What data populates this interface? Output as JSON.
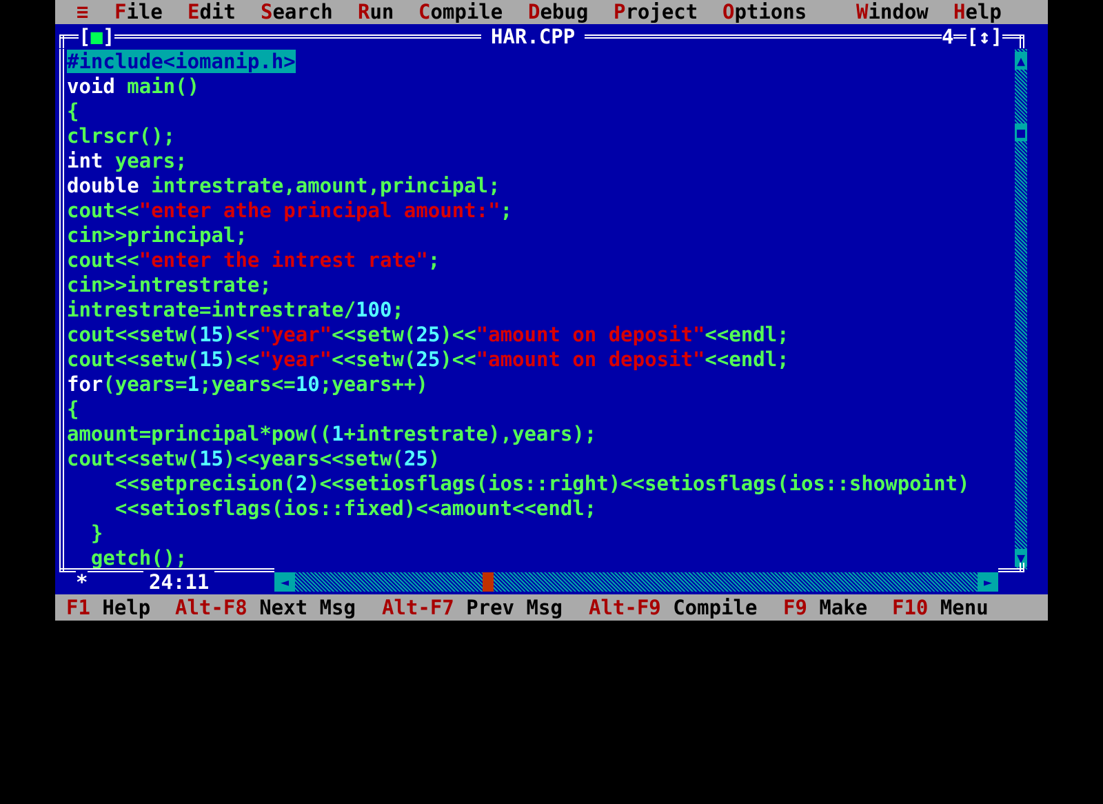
{
  "menu": {
    "system": "≡",
    "items": [
      {
        "hotkey": "F",
        "rest": "ile"
      },
      {
        "hotkey": "E",
        "rest": "dit"
      },
      {
        "hotkey": "S",
        "rest": "earch"
      },
      {
        "hotkey": "R",
        "rest": "un"
      },
      {
        "hotkey": "C",
        "rest": "ompile"
      },
      {
        "hotkey": "D",
        "rest": "ebug"
      },
      {
        "hotkey": "P",
        "rest": "roject"
      },
      {
        "hotkey": "O",
        "rest": "ptions"
      },
      {
        "hotkey": "W",
        "rest": "indow"
      },
      {
        "hotkey": "H",
        "rest": "elp"
      }
    ]
  },
  "window": {
    "title": "HAR.CPP",
    "close_left": "[",
    "close_mark": "■",
    "close_right": "]",
    "number": "4",
    "zoom": "[↕]",
    "cursor_pos": "24:11",
    "modified_mark": "*"
  },
  "editor": {
    "lines": [
      [
        {
          "t": "#include<iomanip.h>",
          "k": "sel"
        }
      ],
      [
        {
          "t": "void",
          "k": "kw"
        },
        {
          "t": " main()",
          "k": "id"
        }
      ],
      [
        {
          "t": "{",
          "k": "id"
        }
      ],
      [
        {
          "t": "clrscr();",
          "k": "id"
        }
      ],
      [
        {
          "t": "int",
          "k": "kw"
        },
        {
          "t": " years;",
          "k": "id"
        }
      ],
      [
        {
          "t": "double",
          "k": "kw"
        },
        {
          "t": " intrestrate,amount,principal;",
          "k": "id"
        }
      ],
      [
        {
          "t": "cout<<",
          "k": "id"
        },
        {
          "t": "\"enter athe principal amount:\"",
          "k": "str"
        },
        {
          "t": ";",
          "k": "id"
        }
      ],
      [
        {
          "t": "cin>>principal;",
          "k": "id"
        }
      ],
      [
        {
          "t": "cout<<",
          "k": "id"
        },
        {
          "t": "\"enter the intrest rate\"",
          "k": "str"
        },
        {
          "t": ";",
          "k": "id"
        }
      ],
      [
        {
          "t": "cin>>intrestrate;",
          "k": "id"
        }
      ],
      [
        {
          "t": "intrestrate=intrestrate/",
          "k": "id"
        },
        {
          "t": "100",
          "k": "num"
        },
        {
          "t": ";",
          "k": "id"
        }
      ],
      [
        {
          "t": "cout<<setw(",
          "k": "id"
        },
        {
          "t": "15",
          "k": "num"
        },
        {
          "t": ")<<",
          "k": "id"
        },
        {
          "t": "\"year\"",
          "k": "str"
        },
        {
          "t": "<<setw(",
          "k": "id"
        },
        {
          "t": "25",
          "k": "num"
        },
        {
          "t": ")<<",
          "k": "id"
        },
        {
          "t": "\"amount on deposit\"",
          "k": "str"
        },
        {
          "t": "<<endl;",
          "k": "id"
        }
      ],
      [
        {
          "t": "cout<<setw(",
          "k": "id"
        },
        {
          "t": "15",
          "k": "num"
        },
        {
          "t": ")<<",
          "k": "id"
        },
        {
          "t": "\"year\"",
          "k": "str"
        },
        {
          "t": "<<setw(",
          "k": "id"
        },
        {
          "t": "25",
          "k": "num"
        },
        {
          "t": ")<<",
          "k": "id"
        },
        {
          "t": "\"amount on deposit\"",
          "k": "str"
        },
        {
          "t": "<<endl;",
          "k": "id"
        }
      ],
      [
        {
          "t": "for",
          "k": "kw"
        },
        {
          "t": "(years=",
          "k": "id"
        },
        {
          "t": "1",
          "k": "num"
        },
        {
          "t": ";years<=",
          "k": "id"
        },
        {
          "t": "10",
          "k": "num"
        },
        {
          "t": ";years++)",
          "k": "id"
        }
      ],
      [
        {
          "t": "{",
          "k": "id"
        }
      ],
      [
        {
          "t": "amount=principal*pow((",
          "k": "id"
        },
        {
          "t": "1",
          "k": "num"
        },
        {
          "t": "+intrestrate),years);",
          "k": "id"
        }
      ],
      [
        {
          "t": "cout<<setw(",
          "k": "id"
        },
        {
          "t": "15",
          "k": "num"
        },
        {
          "t": ")<<years<<setw(",
          "k": "id"
        },
        {
          "t": "25",
          "k": "num"
        },
        {
          "t": ")",
          "k": "id"
        }
      ],
      [
        {
          "t": "    <<setprecision(",
          "k": "id"
        },
        {
          "t": "2",
          "k": "num"
        },
        {
          "t": ")<<setiosflags(ios::right)<<setiosflags(ios::showpoint)",
          "k": "id"
        }
      ],
      [
        {
          "t": "    <<setiosflags(ios::fixed)<<amount<<endl;",
          "k": "id"
        }
      ],
      [
        {
          "t": "  }",
          "k": "id"
        }
      ],
      [
        {
          "t": "  getch();",
          "k": "id"
        }
      ]
    ]
  },
  "status": {
    "items": [
      {
        "key": "F1",
        "label": " Help"
      },
      {
        "key": "Alt-F8",
        "label": " Next Msg"
      },
      {
        "key": "Alt-F7",
        "label": " Prev Msg"
      },
      {
        "key": "Alt-F9",
        "label": " Compile"
      },
      {
        "key": "F9",
        "label": " Make"
      },
      {
        "key": "F10",
        "label": " Menu"
      }
    ]
  },
  "scroll": {
    "up_arrow": "▲",
    "down_arrow": "▼",
    "left_arrow": "◄",
    "right_arrow": "►",
    "thumb": "■"
  },
  "colors": {
    "background": "#0000a8",
    "menubar": "#aaaaaa",
    "hotkey": "#a80000",
    "identifier": "#55ff55",
    "keyword": "#ffffff",
    "string": "#d80000",
    "number": "#55ffff",
    "selection": "#00a8a8"
  }
}
